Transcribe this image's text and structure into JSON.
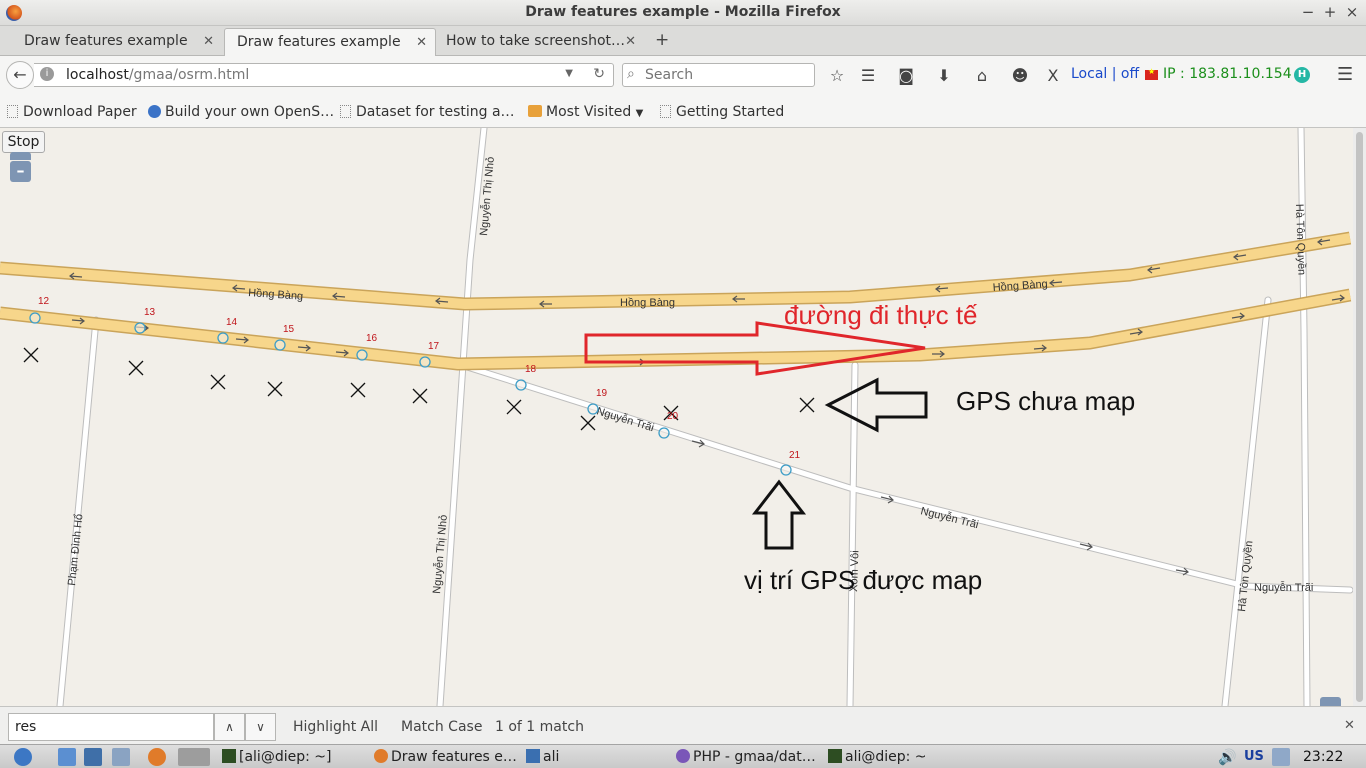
{
  "window": {
    "title": "Draw features example - Mozilla Firefox"
  },
  "tabs": [
    {
      "label": "Draw features example"
    },
    {
      "label": "Draw features example"
    },
    {
      "label": "How to take screenshot…"
    }
  ],
  "nav": {
    "url_host": "localhost",
    "url_path": "/gmaa/osrm.html",
    "search_placeholder": "Search",
    "status_local": "Local | off",
    "ip_text": "IP : 183.81.10.154"
  },
  "bookmarks": [
    {
      "label": "Download Paper"
    },
    {
      "label": "Build your own OpenS…"
    },
    {
      "label": "Dataset for testing a…"
    },
    {
      "label": "Most Visited"
    },
    {
      "label": "Getting Started"
    }
  ],
  "map": {
    "stop_label": "Stop",
    "zoom_out_label": "–",
    "streets": {
      "hong_bang_1": "Hồng Bàng",
      "hong_bang_2": "Hồng Bàng",
      "hong_bang_3": "Hồng Bàng",
      "nguyen_thi_nho_top": "Nguyễn Thị Nhỏ",
      "nguyen_thi_nho_bottom": "Nguyễn Thị Nhỏ",
      "pham_dinh_ho": "Phạm Đình Hổ",
      "nguyen_trai_1": "Nguyễn Trãi",
      "nguyen_trai_2": "Nguyễn Trãi",
      "nguyen_trai_3": "Nguyễn Trãi",
      "ha_ton_quyen_top": "Hà Tôn Quyền",
      "ha_ton_quyen_bottom": "Hà Tôn Quyền",
      "xom_voi": "Xóm Vôi"
    },
    "point_labels": [
      "12",
      "13",
      "14",
      "15",
      "16",
      "17",
      "18",
      "19",
      "20",
      "21"
    ],
    "annotations": {
      "actual_route": "đường đi thực tế",
      "gps_unmapped": "GPS chưa map",
      "gps_mapped": "vị trí GPS được map"
    }
  },
  "findbar": {
    "query": "res",
    "highlight_all": "Highlight All",
    "match_case": "Match Case",
    "result": "1 of 1 match"
  },
  "taskbar": {
    "terminal_1": "[ali@diep: ~]",
    "firefox": "Draw features e…",
    "files": "ali",
    "php": "PHP - gmaa/dat…",
    "terminal_2": "ali@diep: ~",
    "keyboard_layout": "US",
    "clock": "23:22"
  },
  "colors": {
    "primary_road_fill": "#f7d68b",
    "primary_road_casing": "#caa45a",
    "annotation_red": "#e0262b",
    "gps_point_stroke": "#3d9dc7",
    "local_status_blue": "#1a4acb",
    "ip_green": "#1b8f1b"
  }
}
